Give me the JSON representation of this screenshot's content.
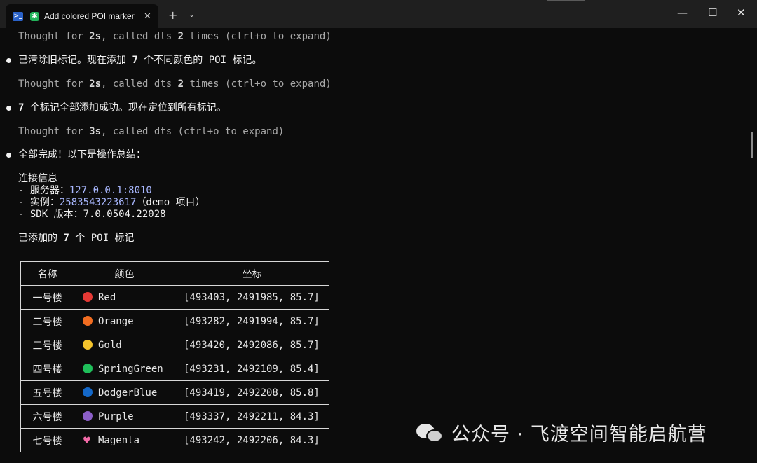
{
  "window": {
    "tab_title": "Add colored POI markers t",
    "tab_close": "✕",
    "new_tab": "+",
    "tab_dropdown": "⌄",
    "minimize": "—",
    "maximize": "☐",
    "close": "✕"
  },
  "terminal": {
    "t1": {
      "pre": "Thought for ",
      "dur": "2s",
      "mid": ", called dts ",
      "count": "2",
      "post": " times (ctrl+o to expand)"
    },
    "m1": {
      "pre": "已清除旧标记。现在添加 ",
      "num": "7",
      "post": " 个不同颜色的 POI 标记。"
    },
    "t2": {
      "pre": "Thought for ",
      "dur": "2s",
      "mid": ", called dts ",
      "count": "2",
      "post": " times (ctrl+o to expand)"
    },
    "m2": {
      "num": "7",
      "post": " 个标记全部添加成功。现在定位到所有标记。"
    },
    "t3": {
      "pre": "Thought for ",
      "dur": "3s",
      "post": ", called dts (ctrl+o to expand)"
    },
    "m3": "全部完成！以下是操作总结：",
    "conn_heading": "连接信息",
    "server_label": "- 服务器：",
    "server_value": "127.0.0.1:8010",
    "instance_label": "- 实例：",
    "instance_value": "2583543223617",
    "instance_note": "（demo 项目）",
    "sdk_line": "- SDK 版本：7.0.0504.22028",
    "poi_heading": {
      "pre": "已添加的 ",
      "num": "7",
      "post": " 个 POI 标记"
    }
  },
  "table": {
    "headers": [
      "名称",
      "颜色",
      "坐标"
    ],
    "rows": [
      {
        "name": "一号楼",
        "color": "Red",
        "swatch": "#e53935",
        "coord": "[493403, 2491985, 85.7]"
      },
      {
        "name": "二号楼",
        "color": "Orange",
        "swatch": "#f26d21",
        "coord": "[493282, 2491994, 85.7]"
      },
      {
        "name": "三号楼",
        "color": "Gold",
        "swatch": "#f5c42c",
        "coord": "[493420, 2492086, 85.7]"
      },
      {
        "name": "四号楼",
        "color": "SpringGreen",
        "swatch": "#1fbf5a",
        "coord": "[493231, 2492109, 85.4]"
      },
      {
        "name": "五号楼",
        "color": "DodgerBlue",
        "swatch": "#1468c8",
        "coord": "[493419, 2492208, 85.8]"
      },
      {
        "name": "六号楼",
        "color": "Purple",
        "swatch": "#8c5fc8",
        "coord": "[493337, 2492211, 84.3]"
      },
      {
        "name": "七号楼",
        "color": "Magenta",
        "swatch": "#f46aa8",
        "swatch_icon": "heart-icon",
        "coord": "[493242, 2492206, 84.3]"
      }
    ]
  },
  "watermark": {
    "text": "公众号 · 飞渡空间智能启航营"
  }
}
